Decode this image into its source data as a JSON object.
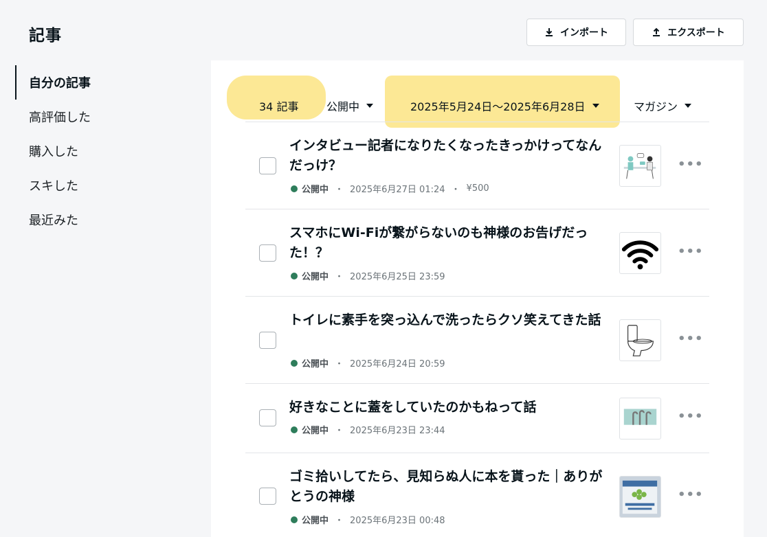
{
  "header": {
    "title": "記事"
  },
  "toolbar": {
    "import_label": "インポート",
    "export_label": "エクスポート"
  },
  "sidebar": {
    "items": [
      {
        "label": "自分の記事",
        "active": true
      },
      {
        "label": "高評価した"
      },
      {
        "label": "購入した"
      },
      {
        "label": "スキした"
      },
      {
        "label": "最近みた"
      }
    ]
  },
  "filters": {
    "count": "34 記事",
    "status": "公開中",
    "date_range": "2025年5月24日〜2025年6月28日",
    "magazine": "マガジン"
  },
  "articles": [
    {
      "title": "インタビュー記者になりたくなったきっかけってなんだっけ？",
      "status": "公開中",
      "date": "2025年6月27日 01:24",
      "price": "¥500",
      "thumb_icon": "people-illustration-icon"
    },
    {
      "title": "スマホにWi-Fiが繋がらないのも神様のお告げだった！？",
      "status": "公開中",
      "date": "2025年6月25日 23:59",
      "thumb_icon": "wifi-icon"
    },
    {
      "title": "トイレに素手を突っ込んで洗ったらクソ笑えてきた話",
      "status": "公開中",
      "date": "2025年6月24日 20:59",
      "thumb_icon": "toilet-icon"
    },
    {
      "title": "好きなことに蓋をしていたのかもねって話",
      "status": "公開中",
      "date": "2025年6月23日 23:44",
      "thumb_icon": "faucet-illustration-icon"
    },
    {
      "title": "ゴミ拾いしてたら、見知らぬ人に本を貰った｜ありがとうの神様",
      "status": "公開中",
      "date": "2025年6月23日 00:48",
      "thumb_icon": "book-photo-icon"
    }
  ],
  "more_label": "•••",
  "colors": {
    "highlight": "#fce68a",
    "status_green": "#2e7d5b"
  }
}
